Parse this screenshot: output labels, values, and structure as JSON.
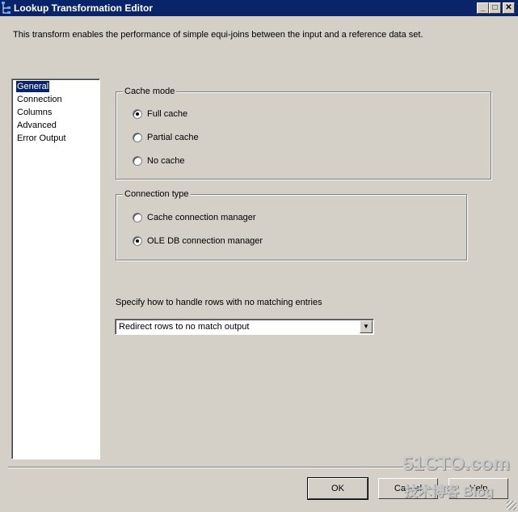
{
  "window": {
    "title": "Lookup Transformation Editor",
    "controls": [
      "minimize",
      "maximize",
      "close"
    ]
  },
  "description": "This transform enables the performance of simple equi-joins between the input and a reference data set.",
  "nav": {
    "items": [
      {
        "label": "General",
        "selected": true
      },
      {
        "label": "Connection"
      },
      {
        "label": "Columns"
      },
      {
        "label": "Advanced"
      },
      {
        "label": "Error Output"
      }
    ]
  },
  "cache_mode": {
    "legend": "Cache mode",
    "options": [
      {
        "label": "Full cache",
        "checked": true
      },
      {
        "label": "Partial cache",
        "checked": false
      },
      {
        "label": "No cache",
        "checked": false
      }
    ]
  },
  "connection_type": {
    "legend": "Connection type",
    "options": [
      {
        "label": "Cache connection manager",
        "checked": false
      },
      {
        "label": "OLE DB connection manager",
        "checked": true
      }
    ]
  },
  "no_match": {
    "label": "Specify how to handle rows with no matching entries",
    "value": "Redirect rows to no match output"
  },
  "buttons": {
    "ok": "OK",
    "cancel": "Cancel",
    "help": "Help"
  },
  "watermark": {
    "line1": "51CTO.com",
    "line2": "技术博客 Blog"
  },
  "colors": {
    "titlebar": "#0a246a",
    "face": "#d4d0c8",
    "selection": "#0a246a"
  }
}
